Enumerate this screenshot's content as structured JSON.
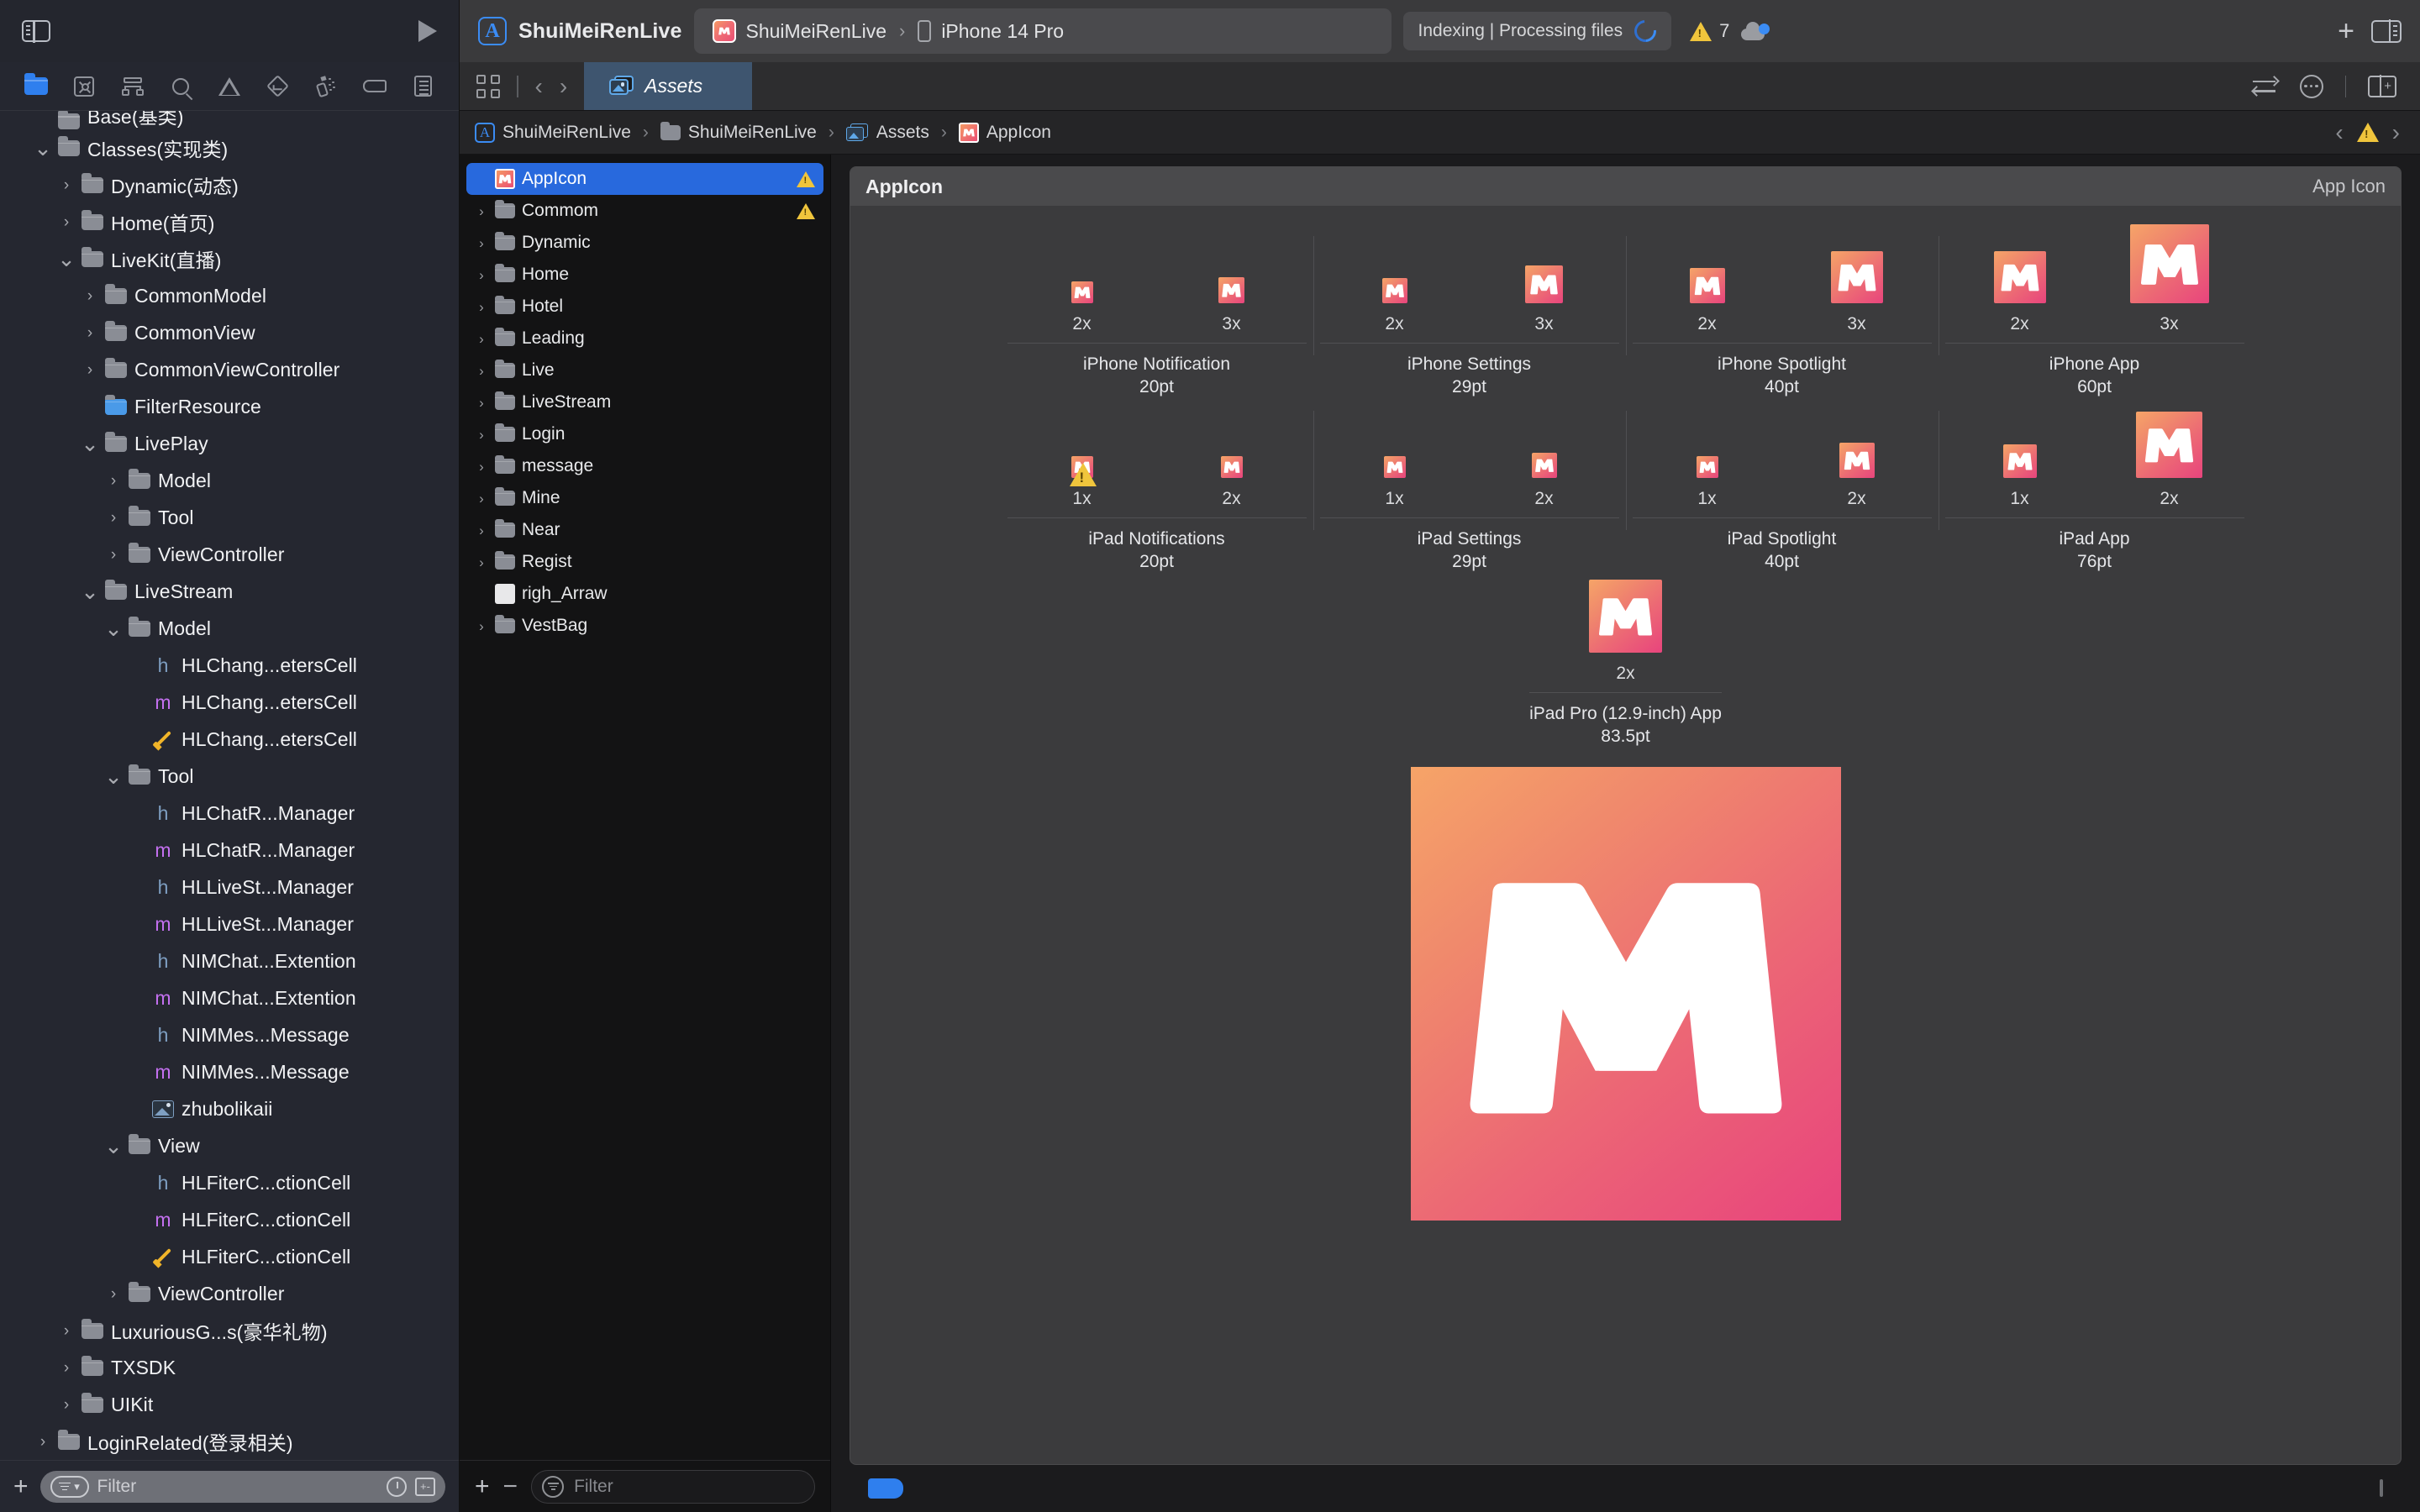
{
  "window": {
    "project_title": "ShuiMeiRenLive",
    "app_icon_name": "appstore-icon"
  },
  "toolbar": {
    "sidebar_toggle": "sidebar-toggle-icon",
    "run_button": "play-icon",
    "scheme": {
      "scheme_name": "ShuiMeiRenLive",
      "separator": "›",
      "destination": "iPhone 14 Pro"
    },
    "status": {
      "text": "Indexing | Processing files",
      "spinner": "progress-spinner"
    },
    "warnings": {
      "count": "7",
      "icon": "warning-triangle-icon"
    },
    "cloud": "cloud-status-icon",
    "add_button": "+",
    "inspector_toggle": "inspector-toggle-icon"
  },
  "navigator": {
    "tabs": [
      {
        "name": "project-navigator",
        "icon": "folder-icon",
        "active": true
      },
      {
        "name": "source-control-navigator",
        "icon": "source-control-icon",
        "active": false
      },
      {
        "name": "symbol-navigator",
        "icon": "hierarchy-icon",
        "active": false
      },
      {
        "name": "find-navigator",
        "icon": "magnifier-icon",
        "active": false
      },
      {
        "name": "issue-navigator",
        "icon": "warning-triangle-icon",
        "active": false
      },
      {
        "name": "test-navigator",
        "icon": "diamond-check-icon",
        "active": false
      },
      {
        "name": "debug-navigator",
        "icon": "spray-icon",
        "active": false
      },
      {
        "name": "breakpoint-navigator",
        "icon": "tag-icon",
        "active": false
      },
      {
        "name": "report-navigator",
        "icon": "list-icon",
        "active": false
      }
    ],
    "tree": [
      {
        "label": "Base(基类)",
        "depth": 1,
        "type": "folder",
        "disclosure": "none",
        "clipped": true
      },
      {
        "label": "Classes(实现类)",
        "depth": 1,
        "type": "folder",
        "disclosure": "open"
      },
      {
        "label": "Dynamic(动态)",
        "depth": 2,
        "type": "folder",
        "disclosure": "closed"
      },
      {
        "label": "Home(首页)",
        "depth": 2,
        "type": "folder",
        "disclosure": "closed"
      },
      {
        "label": "LiveKit(直播)",
        "depth": 2,
        "type": "folder",
        "disclosure": "open"
      },
      {
        "label": "CommonModel",
        "depth": 3,
        "type": "folder",
        "disclosure": "closed"
      },
      {
        "label": "CommonView",
        "depth": 3,
        "type": "folder",
        "disclosure": "closed"
      },
      {
        "label": "CommonViewController",
        "depth": 3,
        "type": "folder",
        "disclosure": "closed"
      },
      {
        "label": "FilterResource",
        "depth": 3,
        "type": "folder-blue",
        "disclosure": "none"
      },
      {
        "label": "LivePlay",
        "depth": 3,
        "type": "folder",
        "disclosure": "open"
      },
      {
        "label": "Model",
        "depth": 4,
        "type": "folder",
        "disclosure": "closed"
      },
      {
        "label": "Tool",
        "depth": 4,
        "type": "folder",
        "disclosure": "closed"
      },
      {
        "label": "ViewController",
        "depth": 4,
        "type": "folder",
        "disclosure": "closed"
      },
      {
        "label": "LiveStream",
        "depth": 3,
        "type": "folder",
        "disclosure": "open"
      },
      {
        "label": "Model",
        "depth": 4,
        "type": "folder",
        "disclosure": "open"
      },
      {
        "label": "HLChang...etersCell",
        "depth": 5,
        "type": "header"
      },
      {
        "label": "HLChang...etersCell",
        "depth": 5,
        "type": "impl"
      },
      {
        "label": "HLChang...etersCell",
        "depth": 5,
        "type": "xib"
      },
      {
        "label": "Tool",
        "depth": 4,
        "type": "folder",
        "disclosure": "open"
      },
      {
        "label": "HLChatR...Manager",
        "depth": 5,
        "type": "header"
      },
      {
        "label": "HLChatR...Manager",
        "depth": 5,
        "type": "impl"
      },
      {
        "label": "HLLiveSt...Manager",
        "depth": 5,
        "type": "header"
      },
      {
        "label": "HLLiveSt...Manager",
        "depth": 5,
        "type": "impl"
      },
      {
        "label": "NIMChat...Extention",
        "depth": 5,
        "type": "header"
      },
      {
        "label": "NIMChat...Extention",
        "depth": 5,
        "type": "impl"
      },
      {
        "label": "NIMMes...Message",
        "depth": 5,
        "type": "header"
      },
      {
        "label": "NIMMes...Message",
        "depth": 5,
        "type": "impl"
      },
      {
        "label": "zhubolikaii",
        "depth": 5,
        "type": "image"
      },
      {
        "label": "View",
        "depth": 4,
        "type": "folder",
        "disclosure": "open"
      },
      {
        "label": "HLFiterC...ctionCell",
        "depth": 5,
        "type": "header"
      },
      {
        "label": "HLFiterC...ctionCell",
        "depth": 5,
        "type": "impl"
      },
      {
        "label": "HLFiterC...ctionCell",
        "depth": 5,
        "type": "xib"
      },
      {
        "label": "ViewController",
        "depth": 4,
        "type": "folder",
        "disclosure": "closed"
      },
      {
        "label": "LuxuriousG...s(豪华礼物)",
        "depth": 2,
        "type": "folder",
        "disclosure": "closed"
      },
      {
        "label": "TXSDK",
        "depth": 2,
        "type": "folder",
        "disclosure": "closed"
      },
      {
        "label": "UIKit",
        "depth": 2,
        "type": "folder",
        "disclosure": "closed"
      },
      {
        "label": "LoginRelated(登录相关)",
        "depth": 1,
        "type": "folder",
        "disclosure": "closed"
      }
    ],
    "bottom": {
      "add_label": "+",
      "filter_placeholder": "Filter",
      "recent_icon": "clock-icon",
      "source-control-filter-icon": "plus-minus-icon"
    }
  },
  "editor": {
    "tabbar": {
      "grid_icon": "grid-layout-icon",
      "back_icon": "chevron-left-icon",
      "forward_icon": "chevron-right-icon",
      "tab_label": "Assets",
      "tab_icon": "assets-catalog-icon",
      "swap_icon": "swap-icon",
      "more_icon": "more-options-icon",
      "split_icon": "add-editor-icon"
    },
    "breadcrumbs": [
      {
        "label": "ShuiMeiRenLive",
        "icon": "appstore-icon"
      },
      {
        "label": "ShuiMeiRenLive",
        "icon": "folder-icon"
      },
      {
        "label": "Assets",
        "icon": "assets-catalog-icon"
      },
      {
        "label": "AppIcon",
        "icon": "appicon-thumb"
      }
    ],
    "breadcrumb_separator": "›",
    "breadcrumb_right": {
      "prev": "‹",
      "warning": "warning-triangle-icon",
      "next": "›"
    }
  },
  "asset_list": {
    "items": [
      {
        "label": "AppIcon",
        "type": "appicon",
        "selected": true,
        "warning": true
      },
      {
        "label": "Commom",
        "type": "folder",
        "selected": false,
        "warning": true
      },
      {
        "label": "Dynamic",
        "type": "folder",
        "selected": false,
        "warning": false
      },
      {
        "label": "Home",
        "type": "folder",
        "selected": false,
        "warning": false
      },
      {
        "label": "Hotel",
        "type": "folder",
        "selected": false,
        "warning": false
      },
      {
        "label": "Leading",
        "type": "folder",
        "selected": false,
        "warning": false
      },
      {
        "label": "Live",
        "type": "folder",
        "selected": false,
        "warning": false
      },
      {
        "label": "LiveStream",
        "type": "folder",
        "selected": false,
        "warning": false
      },
      {
        "label": "Login",
        "type": "folder",
        "selected": false,
        "warning": false
      },
      {
        "label": "message",
        "type": "folder",
        "selected": false,
        "warning": false
      },
      {
        "label": "Mine",
        "type": "folder",
        "selected": false,
        "warning": false
      },
      {
        "label": "Near",
        "type": "folder",
        "selected": false,
        "warning": false
      },
      {
        "label": "Regist",
        "type": "folder",
        "selected": false,
        "warning": false
      },
      {
        "label": "righ_Arraw",
        "type": "imageset",
        "selected": false,
        "warning": false
      },
      {
        "label": "VestBag",
        "type": "folder",
        "selected": false,
        "warning": false
      }
    ],
    "bottom": {
      "add_label": "+",
      "remove_label": "−",
      "filter_placeholder": "Filter"
    }
  },
  "canvas": {
    "card_title": "AppIcon",
    "card_right_label": "App Icon",
    "groups": [
      {
        "name": "iPhone Notification",
        "size": "20pt",
        "row": 1,
        "slots": [
          {
            "scale": "2x",
            "px": 40,
            "warning": false
          },
          {
            "scale": "3x",
            "px": 60,
            "warning": false
          }
        ]
      },
      {
        "name": "iPhone Settings",
        "size": "29pt",
        "row": 1,
        "slots": [
          {
            "scale": "2x",
            "px": 58,
            "warning": false
          },
          {
            "scale": "3x",
            "px": 87,
            "warning": false
          }
        ]
      },
      {
        "name": "iPhone Spotlight",
        "size": "40pt",
        "row": 1,
        "slots": [
          {
            "scale": "2x",
            "px": 80,
            "warning": false
          },
          {
            "scale": "3x",
            "px": 120,
            "warning": false
          }
        ]
      },
      {
        "name": "iPhone App",
        "size": "60pt",
        "row": 1,
        "slots": [
          {
            "scale": "2x",
            "px": 120,
            "warning": false
          },
          {
            "scale": "3x",
            "px": 180,
            "warning": false
          }
        ]
      },
      {
        "name": "iPad Notifications",
        "size": "20pt",
        "row": 2,
        "slots": [
          {
            "scale": "1x",
            "px": 20,
            "warning": true
          },
          {
            "scale": "2x",
            "px": 40,
            "warning": false
          }
        ]
      },
      {
        "name": "iPad Settings",
        "size": "29pt",
        "row": 2,
        "slots": [
          {
            "scale": "1x",
            "px": 29,
            "warning": false
          },
          {
            "scale": "2x",
            "px": 58,
            "warning": false
          }
        ]
      },
      {
        "name": "iPad Spotlight",
        "size": "40pt",
        "row": 2,
        "slots": [
          {
            "scale": "1x",
            "px": 40,
            "warning": false
          },
          {
            "scale": "2x",
            "px": 80,
            "warning": false
          }
        ]
      },
      {
        "name": "iPad App",
        "size": "76pt",
        "row": 2,
        "slots": [
          {
            "scale": "1x",
            "px": 76,
            "warning": false
          },
          {
            "scale": "2x",
            "px": 152,
            "warning": false
          }
        ]
      },
      {
        "name": "iPad Pro (12.9-inch) App",
        "size": "83.5pt",
        "row": 3,
        "slots": [
          {
            "scale": "2x",
            "px": 167,
            "warning": false
          }
        ]
      }
    ],
    "large_preview": {
      "name": "app-icon-large-preview",
      "alt": "AppIcon 1024pt"
    }
  },
  "editor_bottom": {
    "tag": "blue-tag-icon",
    "doc_icon": "document-icon"
  },
  "colors": {
    "accent_blue": "#2f7fee",
    "selection_blue": "#2869dd",
    "warning_yellow": "#f0c53c",
    "icon_gradient_start": "#f6a468",
    "icon_gradient_end": "#e8447d",
    "header_file": "#7e9fc2",
    "impl_file": "#c470f0",
    "xib_file": "#f0b429"
  }
}
